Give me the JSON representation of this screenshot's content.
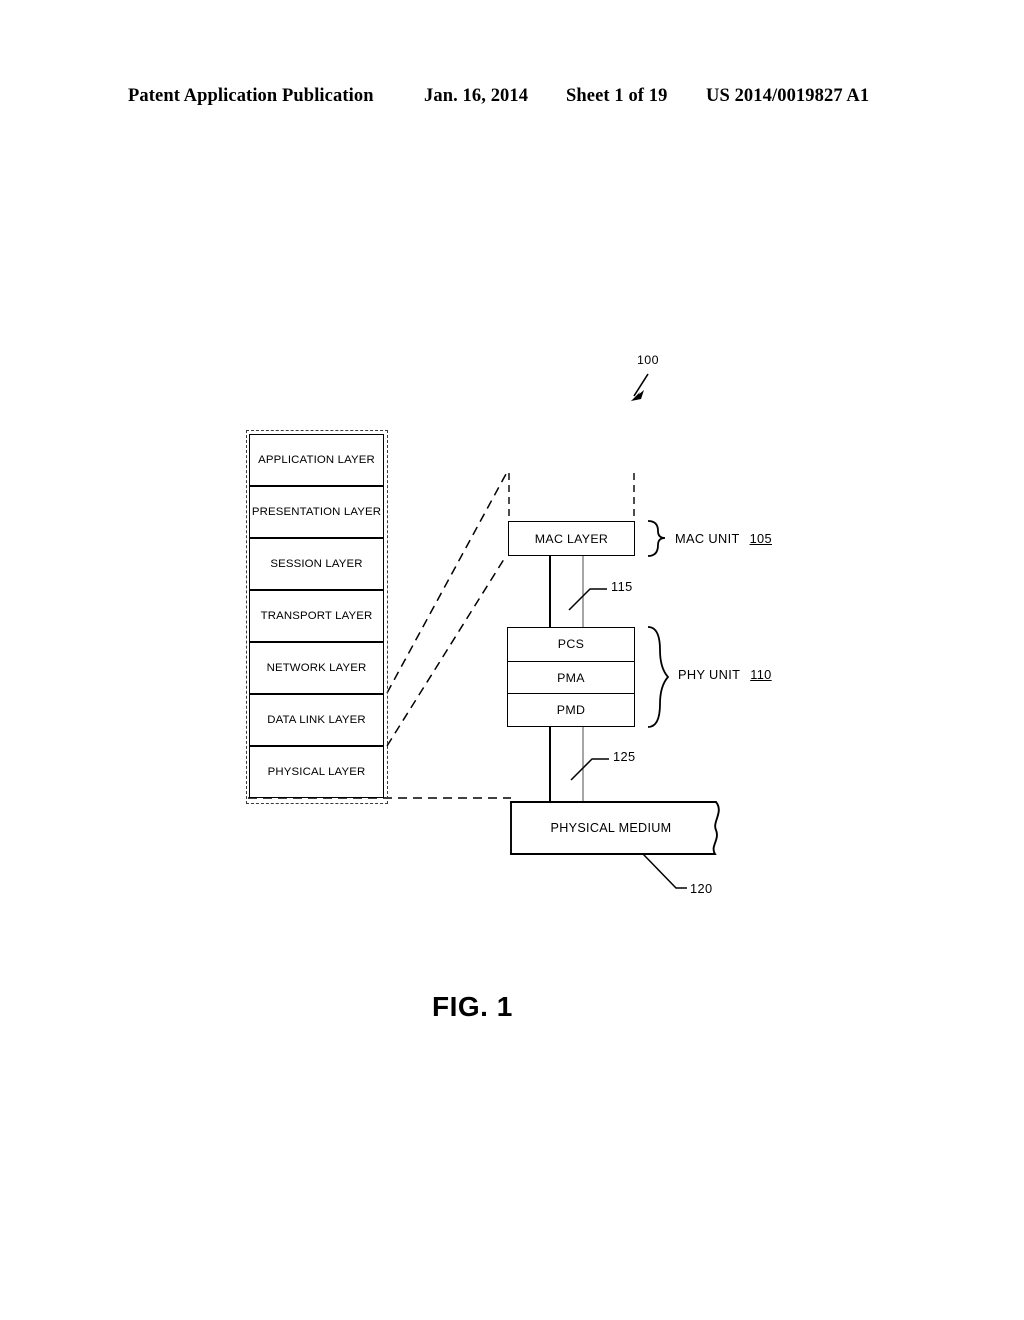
{
  "header": {
    "publication": "Patent Application Publication",
    "date": "Jan. 16, 2014",
    "sheet": "Sheet 1 of 19",
    "patent_number": "US 2014/0019827 A1"
  },
  "figure": {
    "caption": "FIG. 1",
    "system_reference": "100",
    "osi_layers": [
      {
        "label": "APPLICATION LAYER"
      },
      {
        "label": "PRESENTATION LAYER"
      },
      {
        "label": "SESSION LAYER"
      },
      {
        "label": "TRANSPORT LAYER"
      },
      {
        "label": "NETWORK LAYER"
      },
      {
        "label": "DATA LINK LAYER"
      },
      {
        "label": "PHYSICAL LAYER"
      }
    ],
    "mac": {
      "box_label": "MAC LAYER",
      "unit_label": "MAC UNIT",
      "unit_reference": "105"
    },
    "phy": {
      "sublayers": [
        {
          "label": "PCS"
        },
        {
          "label": "PMA"
        },
        {
          "label": "PMD"
        }
      ],
      "unit_label": "PHY UNIT",
      "unit_reference": "110"
    },
    "physical_medium": {
      "label": "PHYSICAL MEDIUM",
      "reference": "120"
    },
    "interface_upper_reference": "115",
    "interface_lower_reference": "125"
  },
  "colors": {
    "ink": "#000000",
    "paper": "#ffffff",
    "dashed": "#3a3a3a"
  }
}
